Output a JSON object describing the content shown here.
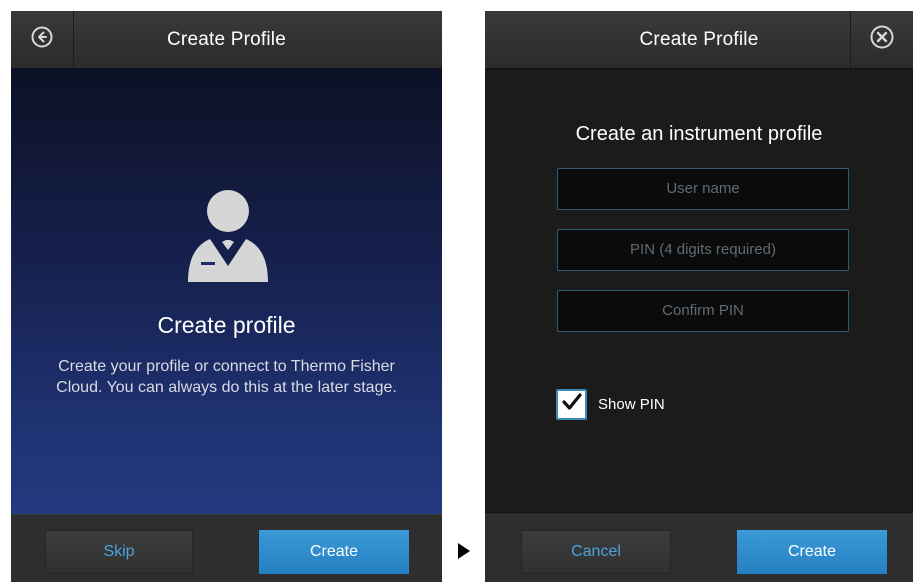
{
  "left_screen": {
    "header": {
      "title": "Create Profile",
      "back_icon": "back-arrow-circle-icon"
    },
    "avatar_icon": "user-profile-icon",
    "heading": "Create profile",
    "description": "Create your profile or connect to Thermo Fisher Cloud. You can always do this at the later stage.",
    "footer": {
      "skip_label": "Skip",
      "create_label": "Create"
    }
  },
  "arrow_icon": "right-triangle-arrow-icon",
  "right_screen": {
    "header": {
      "title": "Create Profile",
      "close_icon": "close-circle-icon"
    },
    "heading": "Create an instrument profile",
    "fields": {
      "username_placeholder": "User name",
      "pin_placeholder": "PIN (4 digits required)",
      "confirm_pin_placeholder": "Confirm PIN"
    },
    "show_pin": {
      "label": "Show PIN",
      "checked": true
    },
    "footer": {
      "cancel_label": "Cancel",
      "create_label": "Create"
    }
  },
  "colors": {
    "accent_blue": "#2a8ad0",
    "link_blue": "#4aa3dc",
    "field_border": "#2f5c74",
    "left_gradient_top": "#0d1125",
    "left_gradient_bottom": "#233a80"
  }
}
